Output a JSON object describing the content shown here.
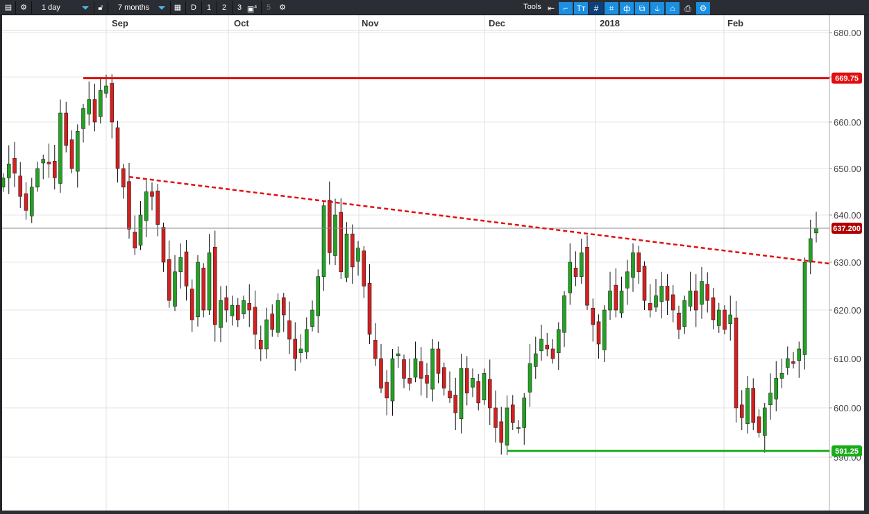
{
  "toolbar": {
    "interval": "1 day",
    "range": "7 months",
    "d": "D",
    "n1": "1",
    "n2": "2",
    "n3": "3",
    "n4": "4",
    "n5": "5",
    "tools": "Tools"
  },
  "months": [
    "Sep",
    "Oct",
    "Nov",
    "Dec",
    "2018",
    "Feb"
  ],
  "chart_data": {
    "type": "candlestick",
    "title": "",
    "x_month_labels": [
      "Sep",
      "Oct",
      "Nov",
      "Dec",
      "2018",
      "Feb"
    ],
    "y_ticks": [
      680,
      670,
      660,
      650,
      640,
      630,
      620,
      610,
      600,
      590
    ],
    "y_tick_labels": [
      "680.00",
      "670.00",
      "660.00",
      "650.00",
      "640.00",
      "630.00",
      "620.00",
      "610.00",
      "600.00",
      "590.00"
    ],
    "closes": [
      648,
      651,
      649,
      644,
      641,
      646,
      650,
      652,
      651,
      648,
      662,
      655,
      650,
      658,
      663,
      665,
      660,
      667,
      668,
      660,
      650,
      646,
      637,
      633,
      640,
      645,
      644,
      638,
      630,
      622,
      628,
      631,
      625,
      618,
      630,
      620,
      632,
      617,
      622,
      620,
      621,
      618,
      622,
      620,
      615,
      612,
      618,
      616,
      622,
      619,
      614,
      610,
      612,
      616,
      620,
      627,
      642,
      632,
      640,
      628,
      636,
      629,
      633,
      625,
      615,
      610,
      604,
      602,
      610,
      611,
      606,
      605,
      610,
      606,
      605,
      612,
      607,
      604,
      602,
      599,
      608,
      603,
      606,
      601,
      607,
      600,
      596,
      593,
      600,
      597,
      596,
      602,
      609,
      611,
      614,
      612,
      610,
      616,
      623,
      630,
      627,
      632,
      621,
      617,
      613,
      620,
      624,
      620,
      624,
      628,
      632,
      628,
      622,
      620,
      623,
      625,
      622,
      620,
      616,
      622,
      624,
      620,
      626,
      622,
      618,
      620,
      616,
      619,
      600,
      598,
      604,
      597,
      595,
      600,
      603,
      606,
      607,
      610,
      609,
      612,
      630,
      635,
      637.2
    ],
    "resistance": {
      "value": 669.75,
      "label": "669.75",
      "color": "#e01010"
    },
    "support": {
      "value": 591.25,
      "label": "591.25",
      "color": "#1aab1a"
    },
    "trendline": {
      "from": 648.2,
      "to": 629.7,
      "color": "#e01010",
      "style": "dashed"
    },
    "last_price": {
      "value": 637.2,
      "label": "637.200",
      "color": "#b00000"
    },
    "up_color": "#22a322",
    "down_color": "#d42020",
    "ylim": [
      585,
      682
    ]
  }
}
